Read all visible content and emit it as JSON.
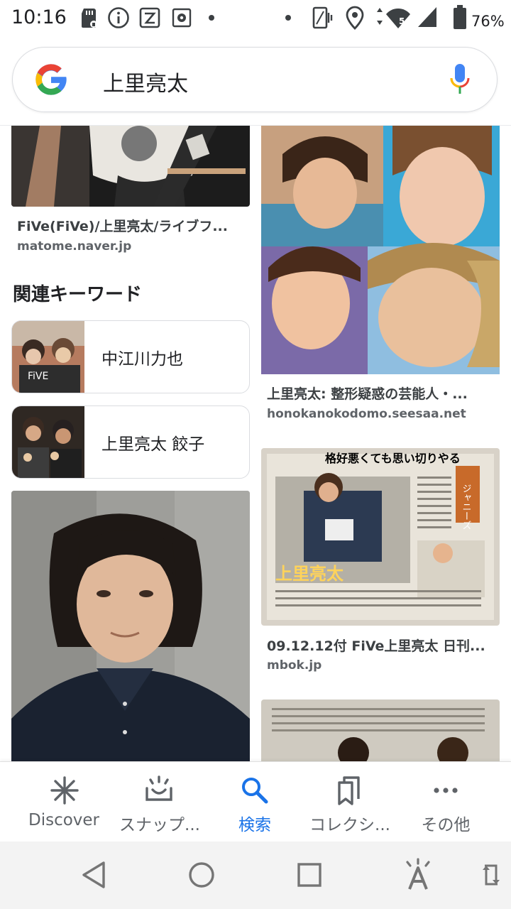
{
  "status_bar": {
    "time": "10:16",
    "battery": "76%",
    "icons": [
      "sd-card-icon",
      "info-icon",
      "nfc-icon",
      "settings-icon",
      "dot-icon",
      "vibrate-icon",
      "location-icon",
      "wifi-icon",
      "signal-icon",
      "battery-icon"
    ]
  },
  "search": {
    "query": "上里亮太",
    "logo_colors": [
      "#4285F4",
      "#EA4335",
      "#FBBC05",
      "#34A853"
    ]
  },
  "left_column": {
    "top_result": {
      "title": "FiVe(FiVe)/上里亮太/ライブフ...",
      "source": "matome.naver.jp"
    },
    "related_keywords": {
      "heading": "関連キーワード",
      "items": [
        {
          "label": "中江川力也",
          "thumb_text": "FiVE"
        },
        {
          "label": "上里亮太 餃子"
        }
      ]
    }
  },
  "right_column": {
    "results": [
      {
        "title": "上里亮太: 整形疑惑の芸能人・...",
        "source": "honokanokodomo.seesaa.net"
      },
      {
        "title": "09.12.12付 FiVe上里亮太 日刊...",
        "source": "mbok.jp",
        "image_text": {
          "headline": "格好悪くても思い切りやる",
          "name": "上里亮太",
          "tag": "ジャニーズ"
        }
      }
    ]
  },
  "bottom_nav": {
    "items": [
      {
        "label": "Discover",
        "icon": "asterisk-icon"
      },
      {
        "label": "スナップ...",
        "icon": "snapshot-icon"
      },
      {
        "label": "検索",
        "icon": "search-icon",
        "active": true
      },
      {
        "label": "コレクシ...",
        "icon": "collections-icon"
      },
      {
        "label": "その他",
        "icon": "more-icon"
      }
    ],
    "active_color": "#1a73e8"
  },
  "system_nav": {
    "icons": [
      "back-icon",
      "home-icon",
      "recents-icon",
      "accessibility-icon",
      "rotate-icon"
    ]
  }
}
